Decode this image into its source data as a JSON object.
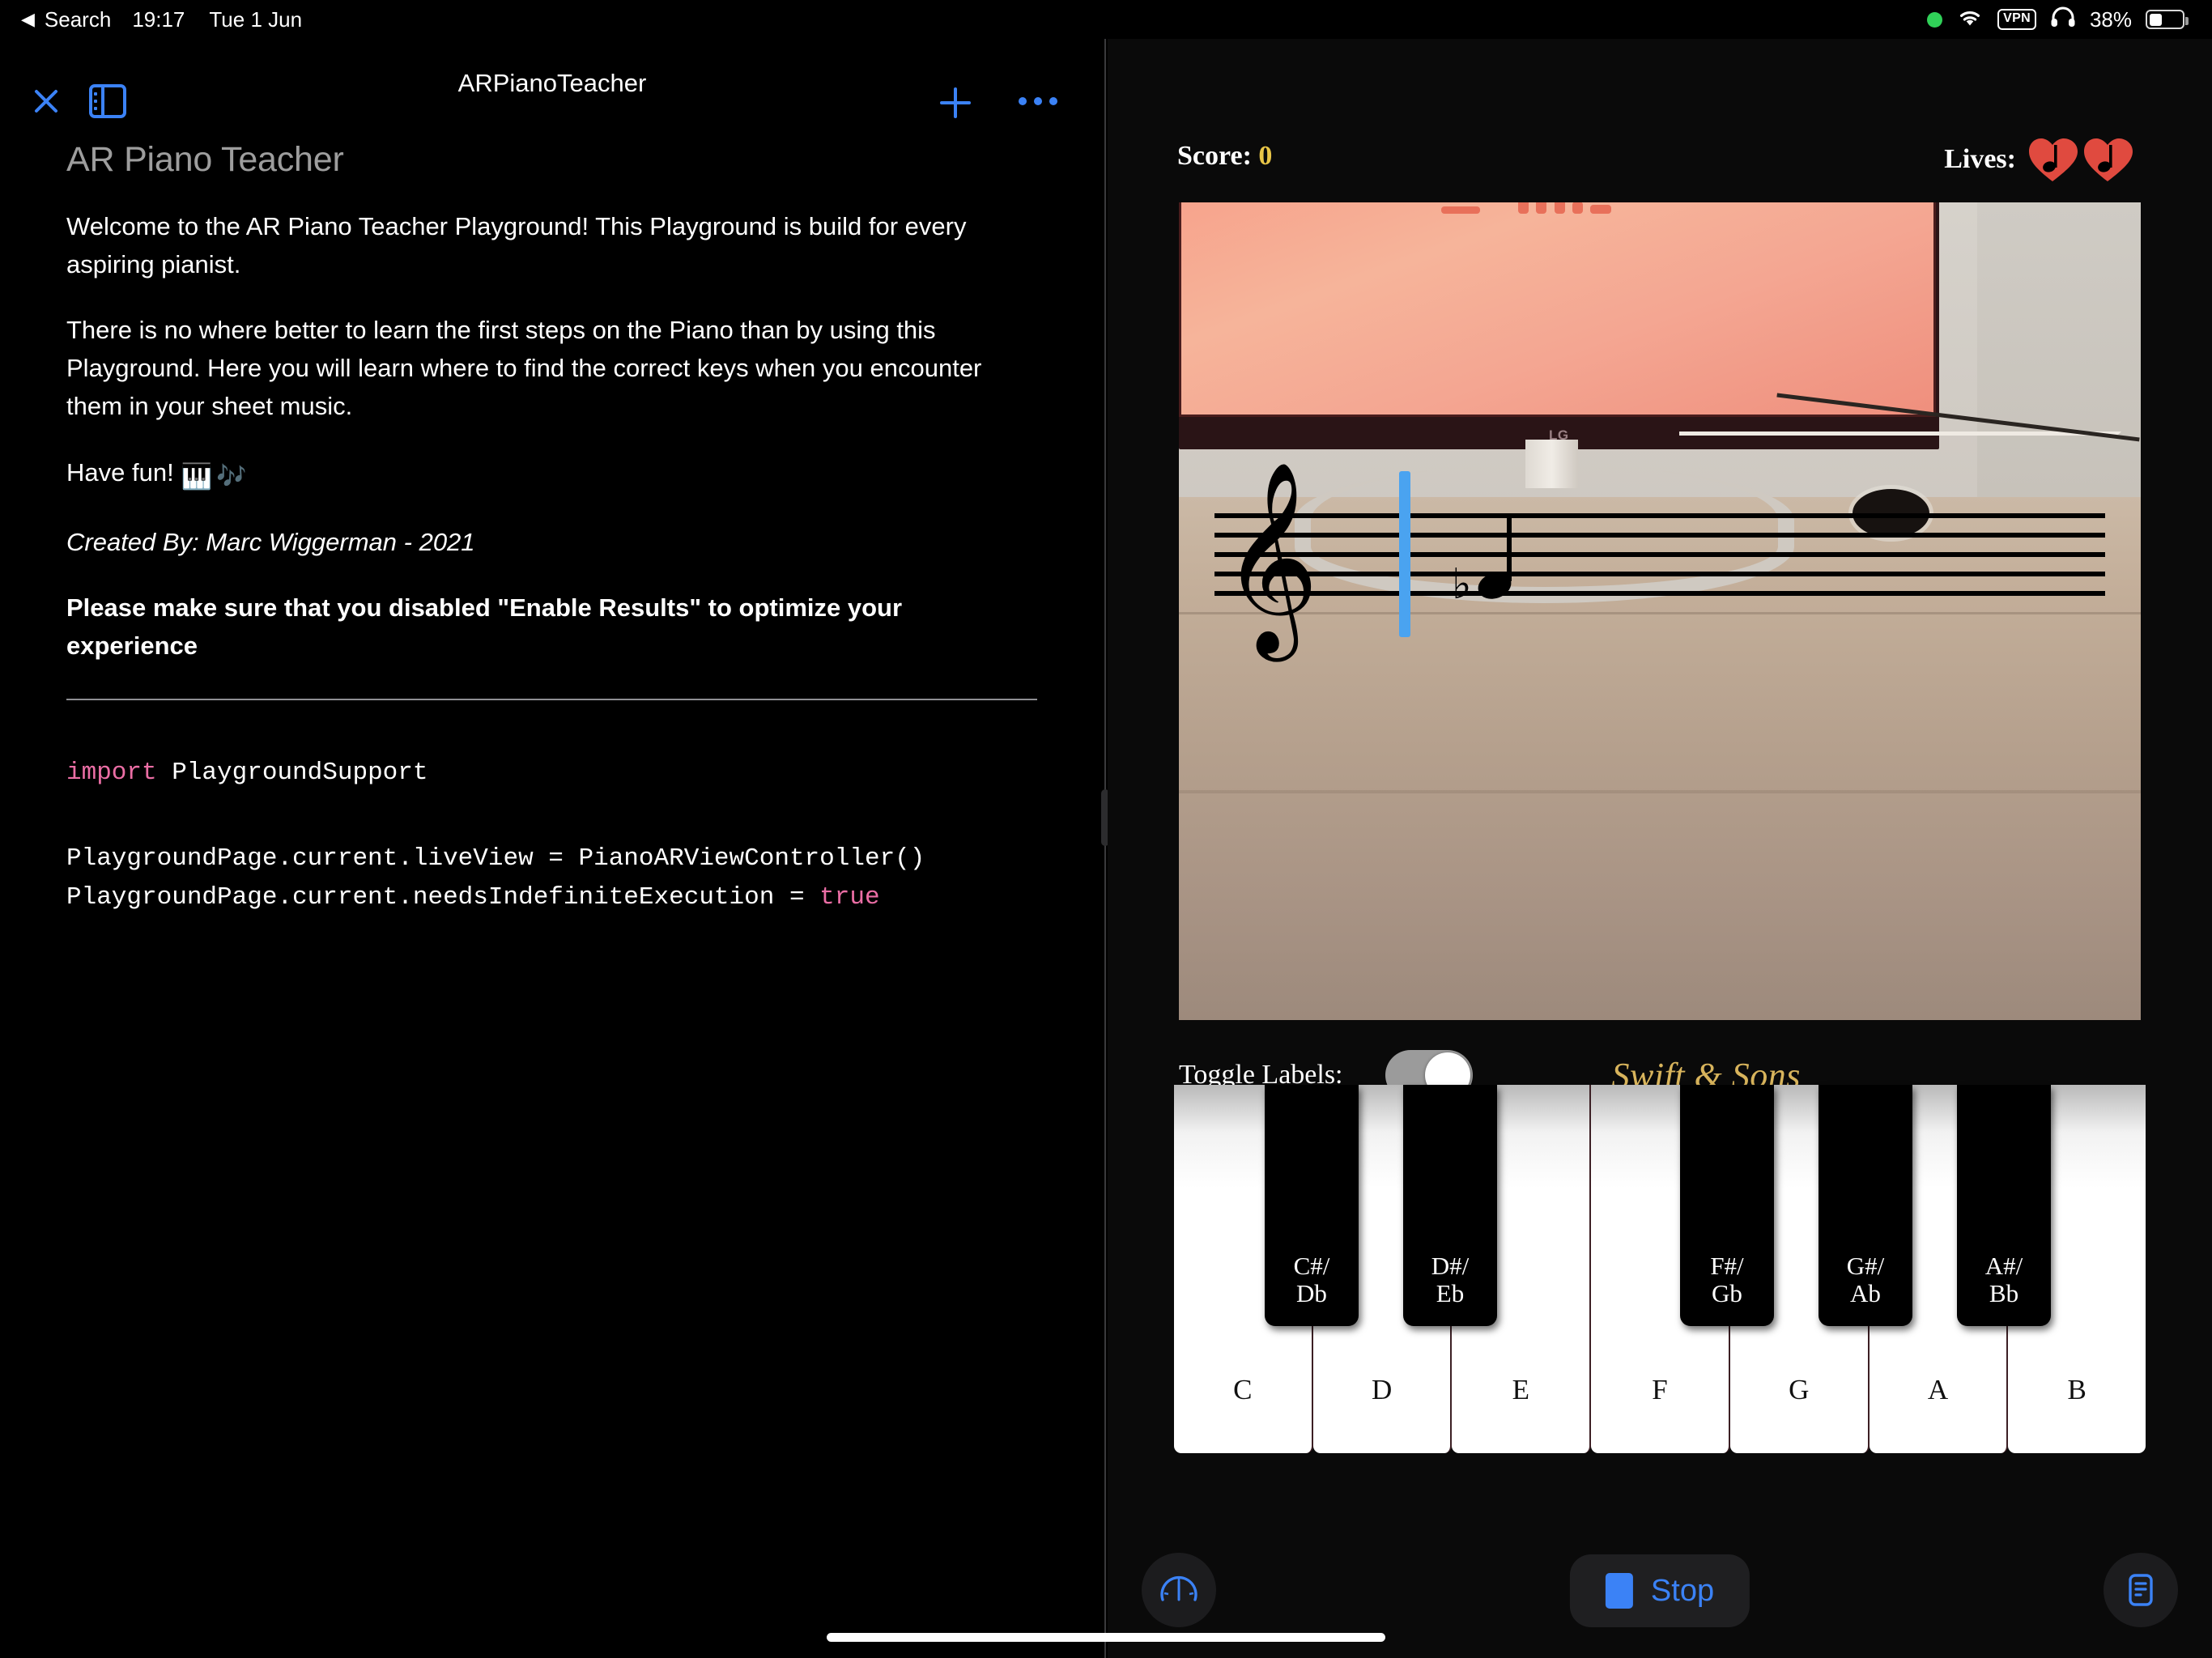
{
  "statusbar": {
    "back_label": "Search",
    "time": "19:17",
    "date": "Tue 1 Jun",
    "vpn_label": "VPN",
    "battery_percent": "38%",
    "icons": [
      "green-dot",
      "wifi-icon",
      "vpn-badge",
      "headphones-icon",
      "battery-icon"
    ]
  },
  "left_panel": {
    "toolbar": {
      "title": "ARPianoTeacher",
      "close_icon": "close-icon",
      "sidebar_icon": "sidebar-toggle-icon",
      "add_icon": "plus-icon",
      "more_icon": "more-options-icon",
      "accent": "#3b82f6"
    },
    "document": {
      "heading": "AR Piano Teacher",
      "paragraphs": [
        "Welcome to the AR Piano Teacher Playground! This Playground is build for every aspiring pianist.",
        "There is no where better to learn the first steps on the Piano than by using this Playground. Here you will learn where to find the correct keys when you encounter them in your sheet music."
      ],
      "have_fun": "Have fun!",
      "have_fun_emoji": "🎹",
      "have_fun_emoji2": "🎶",
      "credit": "Created By: Marc Wiggerman - 2021",
      "notice": "Please make sure that you disabled \"Enable Results\" to optimize your experience",
      "code": {
        "line1_keyword": "import",
        "line1_rest": " PlaygroundSupport",
        "line2": "PlaygroundPage.current.liveView = PianoARViewController()",
        "line3_prefix": "PlaygroundPage.current.needsIndefiniteExecution = ",
        "line3_keyword": "true",
        "keyword_color": "#eb6ea5"
      }
    }
  },
  "right_panel": {
    "hud": {
      "score_label": "Score:",
      "score_value": "0",
      "score_value_color": "#e8c547",
      "lives_label": "Lives:",
      "lives_count": 2,
      "heart_color": "#e04a3f"
    },
    "camera": {
      "monitor_brand": "LG",
      "description": "AR camera view of a desk with an LG monitor"
    },
    "sheet_music": {
      "clef": "𝄞",
      "staff_lines": 5,
      "playhead_color": "#4aa3f0",
      "note_accidental": "♭"
    },
    "controls": {
      "toggle_label": "Toggle Labels:",
      "toggle_on": true,
      "brand": "Swift & Sons",
      "brand_color": "#d8b45c"
    },
    "piano": {
      "white_keys": [
        "C",
        "D",
        "E",
        "F",
        "G",
        "A",
        "B"
      ],
      "black_keys": [
        {
          "top": "C#/",
          "bottom": "Db"
        },
        {
          "top": "D#/",
          "bottom": "Eb"
        },
        {
          "top": "F#/",
          "bottom": "Gb"
        },
        {
          "top": "G#/",
          "bottom": "Ab"
        },
        {
          "top": "A#/",
          "bottom": "Bb"
        }
      ]
    },
    "bottom_bar": {
      "gauge_icon": "speedometer-icon",
      "stop_label": "Stop",
      "report_icon": "document-report-icon",
      "accent": "#3b82f6"
    }
  }
}
